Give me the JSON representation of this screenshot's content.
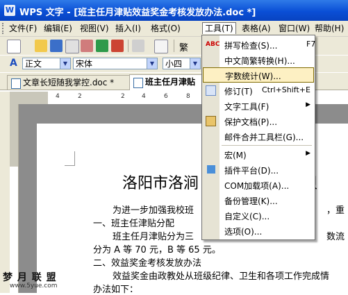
{
  "window": {
    "title": "WPS 文字 - [班主任月津贴效益奖金考核发放办法.doc *]",
    "app_icon": "W"
  },
  "menubar": {
    "items": [
      "文件(F)",
      "编辑(E)",
      "视图(V)",
      "插入(I)",
      "格式(O)",
      "工具(T)",
      "表格(A)",
      "窗口(W)",
      "帮助(H)"
    ],
    "active": "工具(T)"
  },
  "toolbar": {
    "fonts_label": "繁",
    "style_value": "正文",
    "font_value": "宋体",
    "size_value": "小四",
    "style_icon": "A"
  },
  "tabs": [
    {
      "label": "文章长短随我掌控.doc *"
    },
    {
      "label": "班主任月津贴"
    }
  ],
  "ruler": {
    "numbers": [
      "4",
      "2",
      "2",
      "4",
      "6",
      "8",
      "10"
    ]
  },
  "document": {
    "title": "洛阳市洛涧",
    "title_end": "津贝",
    "paragraphs": [
      "为进一步加强我校班",
      "一、班主任津贴分配",
      "班主任月津贴分为三",
      "分为 A 等 70 元，B 等 65 元。",
      "二、效益奖金考核发放办法",
      "效益奖金由政教处从班级纪律、卫生和各项工作完成情",
      "办法如下："
    ],
    "trail_1": "，重",
    "trail_2": "数流"
  },
  "tools_menu": {
    "items": [
      {
        "label": "拼写检查(S)...",
        "shortcut": "F7",
        "icon": "spellcheck-icon"
      },
      {
        "label": "中文简繁转换(H)...",
        "shortcut": "",
        "icon": ""
      },
      {
        "label": "字数统计(W)...",
        "shortcut": "",
        "icon": "",
        "highlight": true
      },
      {
        "label": "修订(T)",
        "shortcut": "Ctrl+Shift+E",
        "icon": "track-changes-icon"
      },
      {
        "label": "文字工具(F)",
        "shortcut": "",
        "icon": "",
        "submenu": true
      },
      {
        "label": "保护文档(P)...",
        "shortcut": "",
        "icon": "protect-icon"
      },
      {
        "label": "邮件合并工具栏(G)...",
        "shortcut": "",
        "icon": ""
      },
      {
        "label": "宏(M)",
        "shortcut": "",
        "icon": "",
        "submenu": true
      },
      {
        "label": "插件平台(D)...",
        "shortcut": "",
        "icon": "plugin-icon"
      },
      {
        "label": "COM加载项(A)...",
        "shortcut": "",
        "icon": ""
      },
      {
        "label": "备份管理(K)...",
        "shortcut": "",
        "icon": ""
      },
      {
        "label": "自定义(C)...",
        "shortcut": "",
        "icon": ""
      },
      {
        "label": "选项(O)...",
        "shortcut": "",
        "icon": ""
      }
    ]
  },
  "watermark": {
    "text": "梦 月 联 盟",
    "url": "www.5yue.com"
  },
  "colors": {
    "titlebar": "#0a4fd6",
    "menu_bg": "#ece9d8",
    "highlight": "#fdf0c3"
  }
}
